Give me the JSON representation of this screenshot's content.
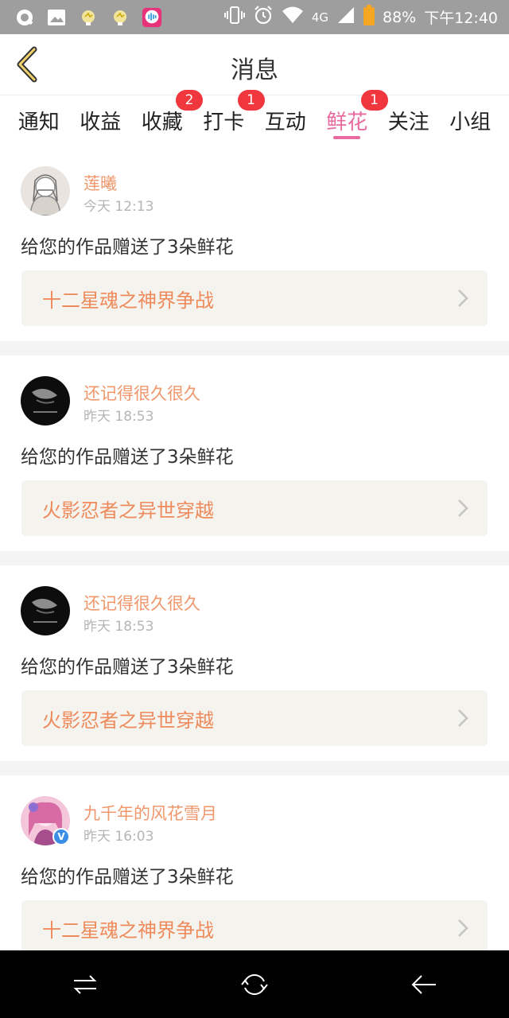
{
  "status_bar": {
    "network": "4G",
    "battery": "88%",
    "time": "下午12:40",
    "icons": [
      "q-app-icon",
      "image-icon",
      "bulb-icon",
      "bulb-icon",
      "voice-app-icon",
      "vibrate-icon",
      "alarm-icon",
      "wifi-icon",
      "signal-icon",
      "battery-icon"
    ]
  },
  "header": {
    "title": "消息"
  },
  "tabs": [
    {
      "label": "通知",
      "badge": ""
    },
    {
      "label": "收益",
      "badge": ""
    },
    {
      "label": "收藏",
      "badge": "2"
    },
    {
      "label": "打卡",
      "badge": "1"
    },
    {
      "label": "互动",
      "badge": ""
    },
    {
      "label": "鲜花",
      "badge": "1",
      "active": true
    },
    {
      "label": "关注",
      "badge": ""
    },
    {
      "label": "小组",
      "badge": ""
    }
  ],
  "messages": [
    {
      "user": "莲曦",
      "time": "今天 12:13",
      "text": "给您的作品赠送了3朵鲜花",
      "work": "十二星魂之神界争战"
    },
    {
      "user": "还记得很久很久",
      "time": "昨天 18:53",
      "text": "给您的作品赠送了3朵鲜花",
      "work": "火影忍者之异世穿越"
    },
    {
      "user": "还记得很久很久",
      "time": "昨天 18:53",
      "text": "给您的作品赠送了3朵鲜花",
      "work": "火影忍者之异世穿越"
    },
    {
      "user": "九千年的风花雪月",
      "time": "昨天 16:03",
      "text": "给您的作品赠送了3朵鲜花",
      "work": "十二星魂之神界争战",
      "verified": "V"
    }
  ],
  "colors": {
    "accent": "#e96a9f",
    "badge": "#f0373e",
    "name": "#f0976b",
    "work": "#ee8a5b"
  }
}
